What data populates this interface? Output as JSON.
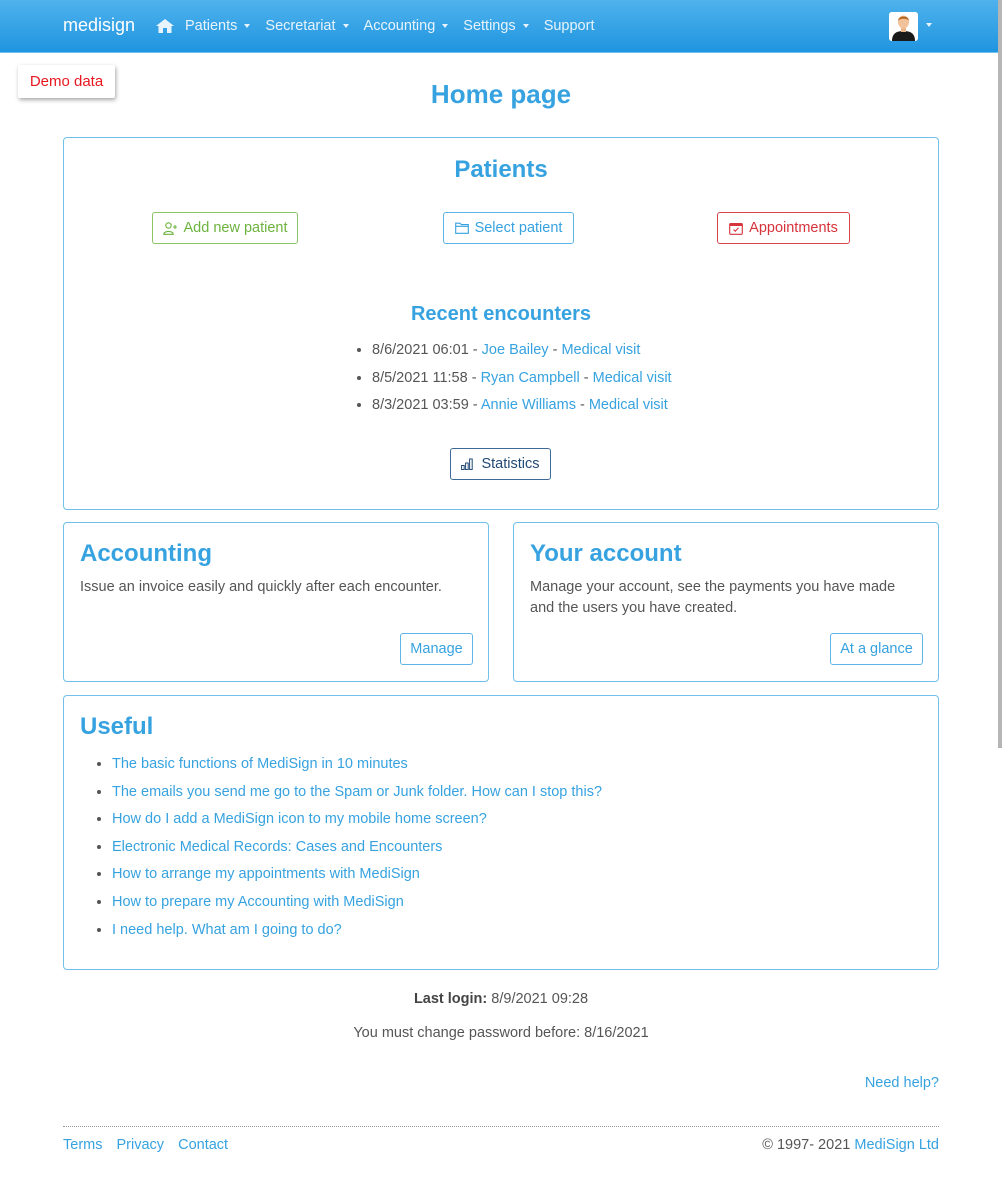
{
  "navbar": {
    "brand": "medisign",
    "items": [
      {
        "label": "Patients",
        "dropdown": true
      },
      {
        "label": "Secretariat",
        "dropdown": true
      },
      {
        "label": "Accounting",
        "dropdown": true
      },
      {
        "label": "Settings",
        "dropdown": true
      },
      {
        "label": "Support",
        "dropdown": false
      }
    ],
    "home_icon": "home-icon",
    "user_icon": "user-avatar"
  },
  "demo_badge": "Demo data",
  "page_title": "Home page",
  "patients": {
    "title": "Patients",
    "buttons": {
      "add": "Add new patient",
      "select": "Select patient",
      "appointments": "Appointments"
    },
    "recent_title": "Recent encounters",
    "encounters": [
      {
        "datetime": "8/6/2021 06:01",
        "patient": "Joe Bailey",
        "type": "Medical visit"
      },
      {
        "datetime": "8/5/2021 11:58",
        "patient": "Ryan Campbell",
        "type": "Medical visit"
      },
      {
        "datetime": "8/3/2021 03:59",
        "patient": "Annie Williams",
        "type": "Medical visit"
      }
    ],
    "separator": " - ",
    "statistics": "Statistics"
  },
  "accounting": {
    "title": "Accounting",
    "text": "Issue an invoice easily and quickly after each encounter.",
    "button": "Manage"
  },
  "account": {
    "title": "Your account",
    "text": "Manage your account, see the payments you have made and the users you have created.",
    "button": "At a glance"
  },
  "useful": {
    "title": "Useful",
    "links": [
      "The basic functions of MediSign in 10 minutes",
      "The emails you send me go to the Spam or Junk folder. How can I stop this?",
      "How do I add a MediSign icon to my mobile home screen?",
      "Electronic Medical Records: Cases and Encounters",
      "How to arrange my appointments with MediSign",
      "How to prepare my Accounting with MediSign",
      "I need help. What am I going to do?"
    ]
  },
  "login": {
    "label": "Last login:",
    "value": "8/9/2021 09:28",
    "password_notice": "You must change password before: 8/16/2021"
  },
  "need_help": "Need help?",
  "footer": {
    "links": [
      "Terms",
      "Privacy",
      "Contact"
    ],
    "copyright": "© 1997- 2021 ",
    "company": "MediSign Ltd"
  },
  "colors": {
    "primary": "#36a2e0",
    "success": "#6db33f",
    "danger": "#d6333b",
    "dark": "#234a75",
    "demo": "#e8161f"
  }
}
